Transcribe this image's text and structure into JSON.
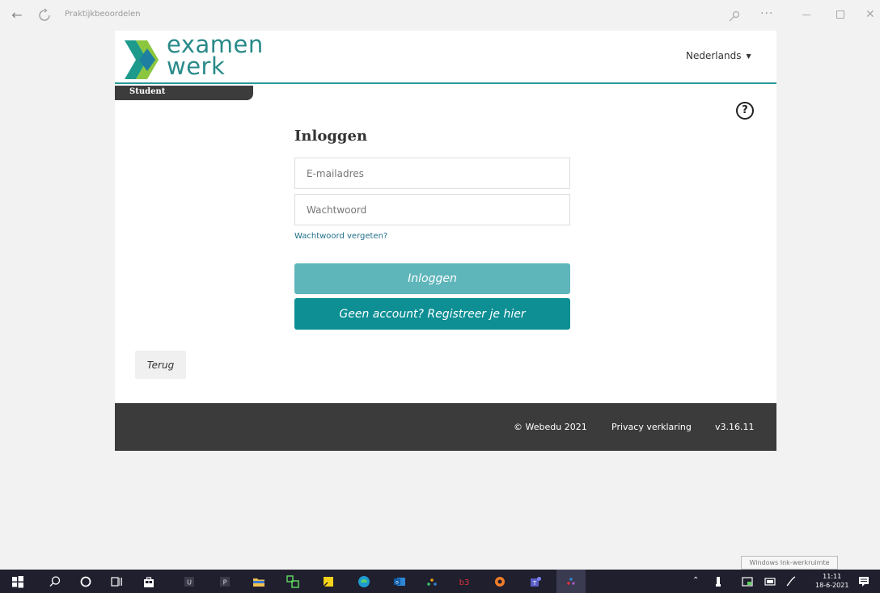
{
  "window": {
    "title": "Praktijkbeoordelen"
  },
  "header": {
    "logo_line1": "examen",
    "logo_line2": "werk",
    "language": "Nederlands",
    "role": "Student",
    "help_symbol": "?"
  },
  "login": {
    "title": "Inloggen",
    "email_placeholder": "E-mailadres",
    "password_placeholder": "Wachtwoord",
    "forgot_link": "Wachtwoord vergeten?",
    "login_button": "Inloggen",
    "register_button": "Geen account? Registreer je hier",
    "back_button": "Terug"
  },
  "footer": {
    "copyright": "© Webedu 2021",
    "privacy": "Privacy verklaring",
    "version": "v3.16.11"
  },
  "tooltip": "Windows Ink-werkruimte",
  "taskbar": {
    "time": "11:11",
    "date": "18-6-2021",
    "apps": [
      "windows-start",
      "search",
      "cortana",
      "task-view",
      "store",
      "app-u",
      "app-p",
      "file-explorer",
      "app-green",
      "sticky-notes",
      "edge",
      "outlook",
      "app-dots",
      "b3",
      "app-orange",
      "teams",
      "app-active"
    ]
  },
  "colors": {
    "brand_teal": "#2a9a97",
    "login_button": "#5eb5ba",
    "register_button": "#0d8f94",
    "footer_bg": "#3b3b3b",
    "taskbar_bg": "#1f1f2e"
  }
}
